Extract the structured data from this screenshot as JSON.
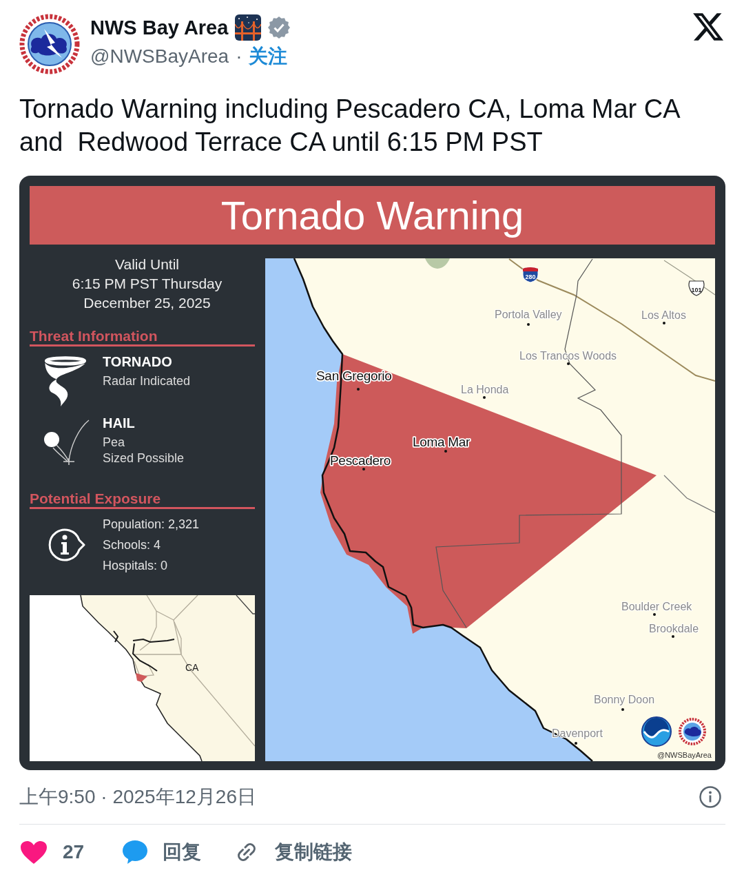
{
  "post": {
    "author": {
      "name": "NWS Bay Area",
      "verified": true,
      "handle": "@NWSBayArea",
      "separator": "·",
      "follow": "关注"
    },
    "text": "Tornado Warning including Pescadero CA, Loma Mar CA and  Redwood Terrace CA until 6:15 PM PST"
  },
  "alert_card": {
    "banner": "Tornado Warning",
    "valid_until": {
      "label": "Valid Until",
      "time": "6:15 PM PST Thursday",
      "date": "December 25, 2025"
    },
    "threat_heading": "Threat Information",
    "threats": [
      {
        "kind": "tornado",
        "title": "TORNADO",
        "details": [
          "Radar Indicated"
        ]
      },
      {
        "kind": "hail",
        "title": "HAIL",
        "details": [
          "Pea",
          "Sized Possible"
        ]
      }
    ],
    "exposure_heading": "Potential Exposure",
    "exposure": [
      "Population: 2,321",
      "Schools: 4",
      "Hospitals: 0"
    ],
    "inset_map": {
      "state_label": "CA"
    },
    "map": {
      "highways": [
        {
          "kind": "interstate",
          "label": "280"
        },
        {
          "kind": "us_route",
          "label": "101"
        }
      ],
      "places": [
        {
          "label": "Portola Valley",
          "emphasized": false
        },
        {
          "label": "Los Altos",
          "emphasized": false
        },
        {
          "label": "Los Trancos Woods",
          "emphasized": false
        },
        {
          "label": "San Gregorio",
          "emphasized": true
        },
        {
          "label": "La Honda",
          "emphasized": false
        },
        {
          "label": "Loma Mar",
          "emphasized": true
        },
        {
          "label": "Pescadero",
          "emphasized": true
        },
        {
          "label": "Boulder Creek",
          "emphasized": false
        },
        {
          "label": "Brookdale",
          "emphasized": false
        },
        {
          "label": "Bonny Doon",
          "emphasized": false
        },
        {
          "label": "Davenport",
          "emphasized": false
        }
      ],
      "credit": "@NWSBayArea"
    }
  },
  "meta": {
    "timestamp": "上午9:50 · 2025年12月26日"
  },
  "actions": [
    {
      "kind": "like",
      "label": "27"
    },
    {
      "kind": "reply",
      "label": "回复"
    },
    {
      "kind": "copy_link",
      "label": "复制链接"
    }
  ]
}
